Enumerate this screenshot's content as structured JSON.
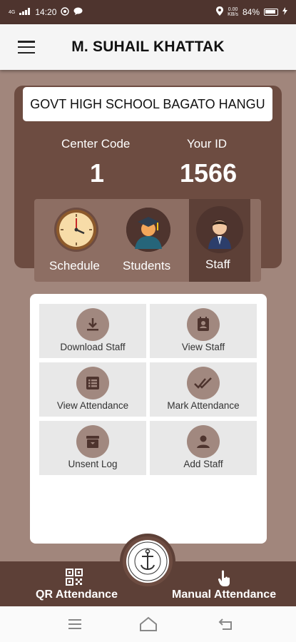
{
  "status_bar": {
    "network": "4G",
    "time": "14:20",
    "speed_value": "0.00",
    "speed_unit": "KB/s",
    "battery": "84%"
  },
  "app_bar": {
    "title": "M. SUHAIL KHATTAK",
    "menu_icon": "hamburger-icon"
  },
  "school": {
    "name": "GOVT HIGH SCHOOL BAGATO HANGU",
    "center_code_label": "Center Code",
    "center_code": "1",
    "id_label": "Your ID",
    "id_value": "1566"
  },
  "tabs": [
    {
      "label": "Schedule",
      "icon": "clock-icon"
    },
    {
      "label": "Students",
      "icon": "graduate-icon"
    },
    {
      "label": "Staff",
      "icon": "staff-person-icon",
      "selected": true
    }
  ],
  "actions": [
    {
      "label": "Download Staff",
      "icon": "download-icon"
    },
    {
      "label": "View Staff",
      "icon": "contact-card-icon"
    },
    {
      "label": "View Attendance",
      "icon": "list-icon"
    },
    {
      "label": "Mark Attendance",
      "icon": "double-check-icon"
    },
    {
      "label": "Unsent Log",
      "icon": "archive-icon"
    },
    {
      "label": "Add Staff",
      "icon": "person-icon"
    }
  ],
  "bottom_bar": {
    "qr_label": "QR Attendance",
    "manual_label": "Manual Attendance",
    "qr_icon": "qr-code-icon",
    "manual_icon": "touch-icon"
  },
  "colors": {
    "primary_dark": "#4e342e",
    "primary": "#6d4c41",
    "tab_active": "#5d4037",
    "tile_icon": "#a1887f",
    "background": "#a1867c"
  }
}
